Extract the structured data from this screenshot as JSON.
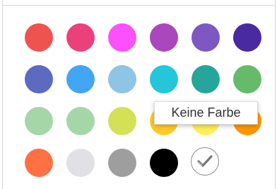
{
  "palette": {
    "rows": [
      [
        {
          "name": "red",
          "color": "#ef5350"
        },
        {
          "name": "pink",
          "color": "#ec407a"
        },
        {
          "name": "magenta",
          "color": "#fb50fb"
        },
        {
          "name": "purple",
          "color": "#ab47bc"
        },
        {
          "name": "deep-purple",
          "color": "#7e57c2"
        },
        {
          "name": "indigo-dark",
          "color": "#4a2aa0"
        }
      ],
      [
        {
          "name": "indigo",
          "color": "#5c6bc0"
        },
        {
          "name": "blue",
          "color": "#42a5f5"
        },
        {
          "name": "light-blue",
          "color": "#8ec4e4"
        },
        {
          "name": "cyan",
          "color": "#26c6da"
        },
        {
          "name": "teal",
          "color": "#26a69a"
        },
        {
          "name": "green",
          "color": "#66bb6a"
        }
      ],
      [
        {
          "name": "light-green-1",
          "color": "#a5d6a7"
        },
        {
          "name": "light-green-2",
          "color": "#a5d6a7"
        },
        {
          "name": "lime",
          "color": "#d4e157"
        },
        {
          "name": "amber",
          "color": "#ffca28"
        },
        {
          "name": "yellow-hidden",
          "color": "#ffee58"
        },
        {
          "name": "orange",
          "color": "#ff9800"
        }
      ],
      [
        {
          "name": "deep-orange",
          "color": "#ff7043"
        },
        {
          "name": "light-gray",
          "color": "#e0e0e6"
        },
        {
          "name": "gray",
          "color": "#9e9e9e"
        },
        {
          "name": "black",
          "color": "#000000"
        }
      ]
    ],
    "no_color": {
      "icon": "checkmark-icon",
      "border_color": "#8a8a8a",
      "check_color": "#777777"
    }
  },
  "tooltip": {
    "label": "Keine Farbe"
  }
}
